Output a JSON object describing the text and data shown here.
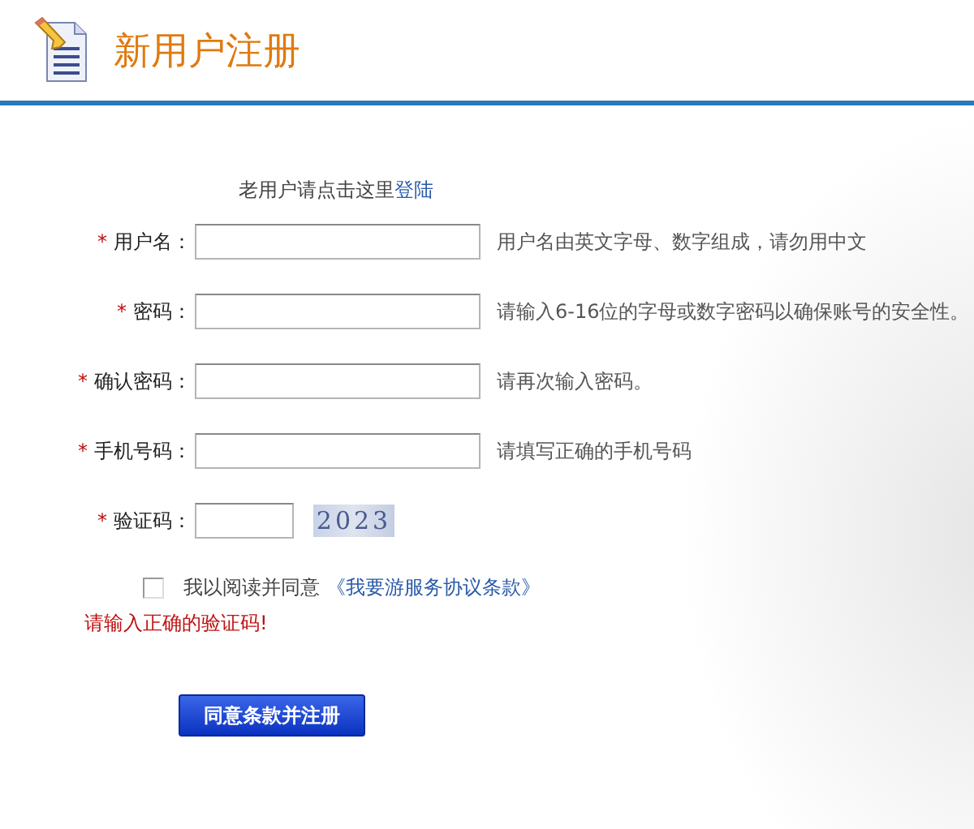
{
  "header": {
    "title": "新用户注册"
  },
  "login_prompt": {
    "text": "老用户请点击这里",
    "link": "登陆"
  },
  "fields": [
    {
      "kind": "text",
      "required_mark": "*",
      "label": "用户名：",
      "hint": "用户名由英文字母、数字组成，请勿用中文"
    },
    {
      "kind": "text",
      "required_mark": "*",
      "label": "密码：",
      "hint": "请输入6-16位的字母或数字密码以确保账号的安全性。"
    },
    {
      "kind": "text",
      "required_mark": "*",
      "label": "确认密码：",
      "hint": "请再次输入密码。"
    },
    {
      "kind": "text",
      "required_mark": "*",
      "label": "手机号码：",
      "hint": "请填写正确的手机号码"
    },
    {
      "kind": "captcha",
      "required_mark": "*",
      "label": "验证码：",
      "captcha": "2023"
    }
  ],
  "agreement": {
    "checked": false,
    "text": "我以阅读并同意",
    "link": "《我要游服务协议条款》"
  },
  "error": "请输入正确的验证码!",
  "submit_button": "同意条款并注册"
}
